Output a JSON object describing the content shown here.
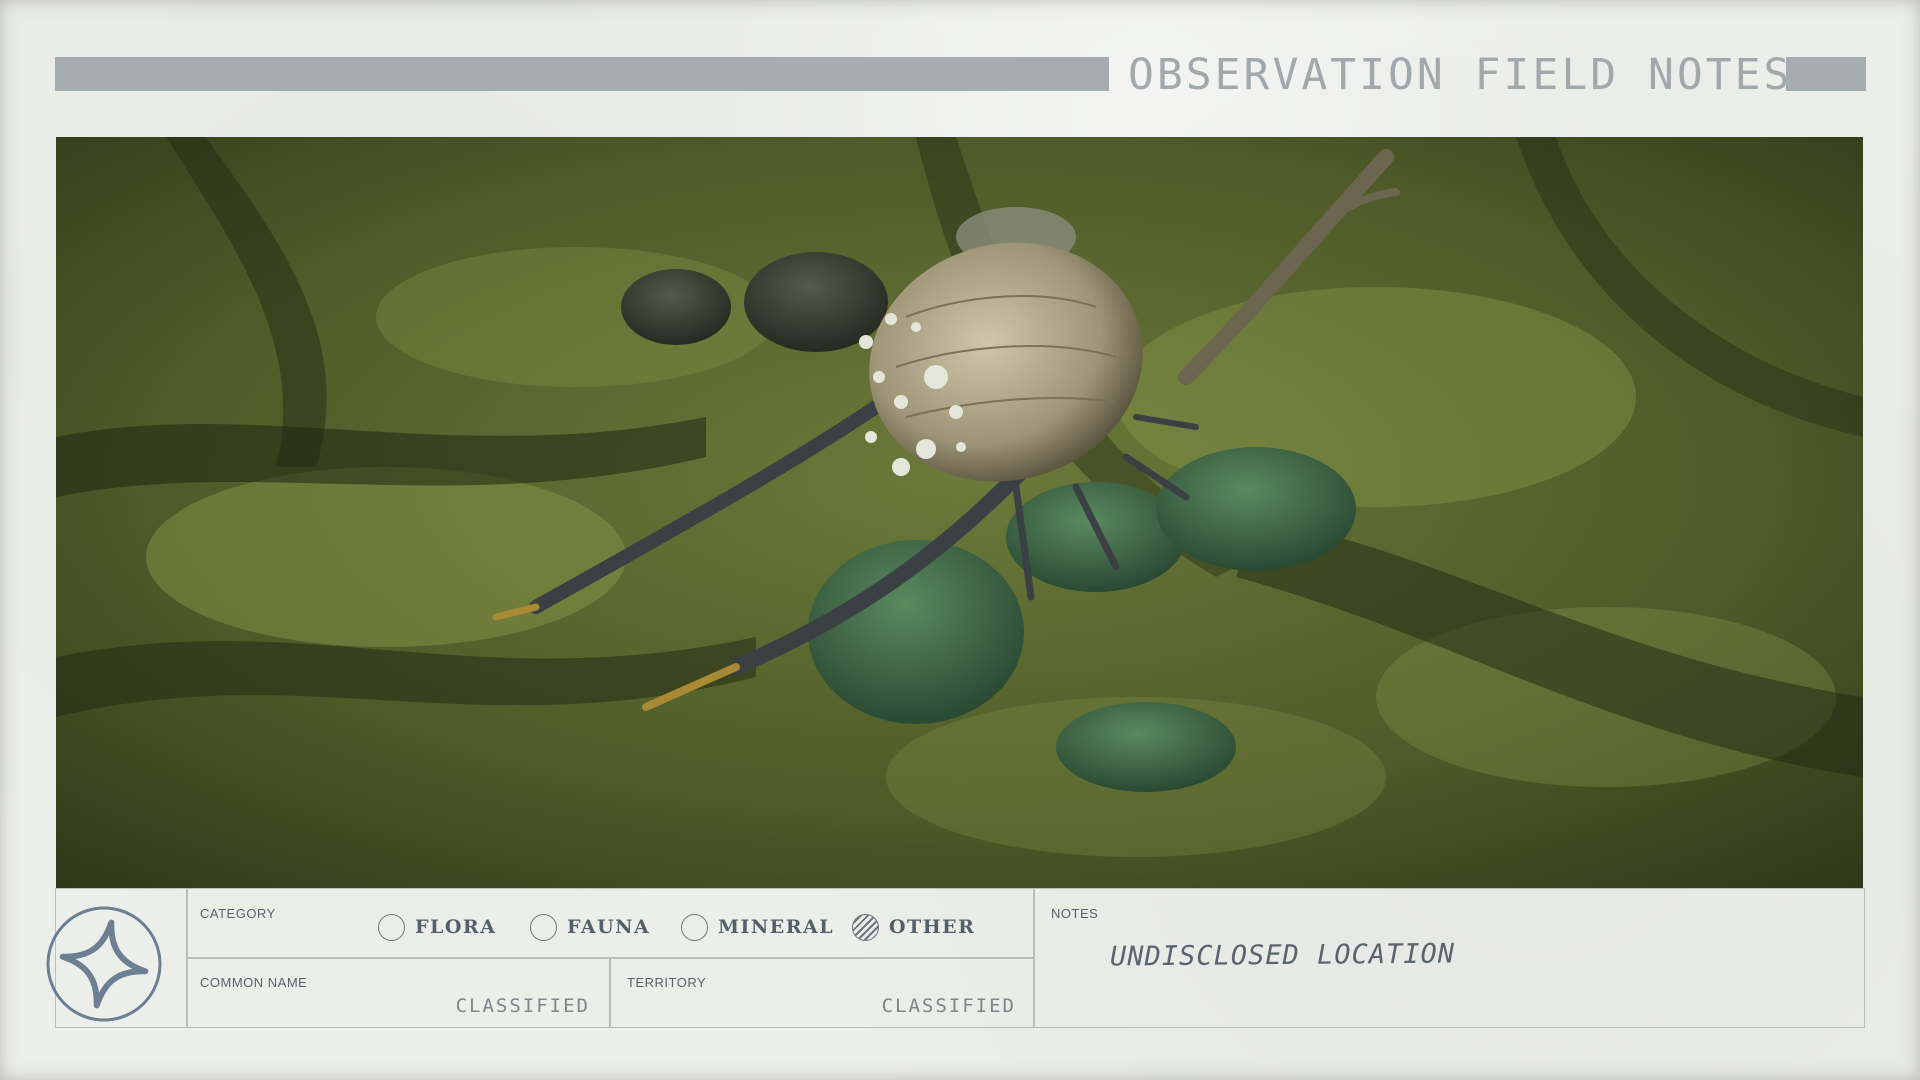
{
  "header": {
    "title": "OBSERVATION FIELD NOTES"
  },
  "photo": {
    "subject": "creature-screenshot"
  },
  "category": {
    "label": "CATEGORY",
    "options": [
      {
        "label": "FLORA",
        "selected": false
      },
      {
        "label": "FAUNA",
        "selected": false
      },
      {
        "label": "MINERAL",
        "selected": false
      },
      {
        "label": "OTHER",
        "selected": true
      }
    ]
  },
  "common_name": {
    "label": "COMMON NAME",
    "value": "CLASSIFIED"
  },
  "territory": {
    "label": "TERRITORY",
    "value": "CLASSIFIED"
  },
  "notes": {
    "label": "NOTES",
    "value": "UNDISCLOSED LOCATION"
  },
  "colors": {
    "paper": "#eceeea",
    "header_bar": "#a5acaf",
    "ink": "#53606a",
    "rule": "#b8bdbd"
  },
  "icons": {
    "emblem": "compass-star-stamp-icon"
  }
}
